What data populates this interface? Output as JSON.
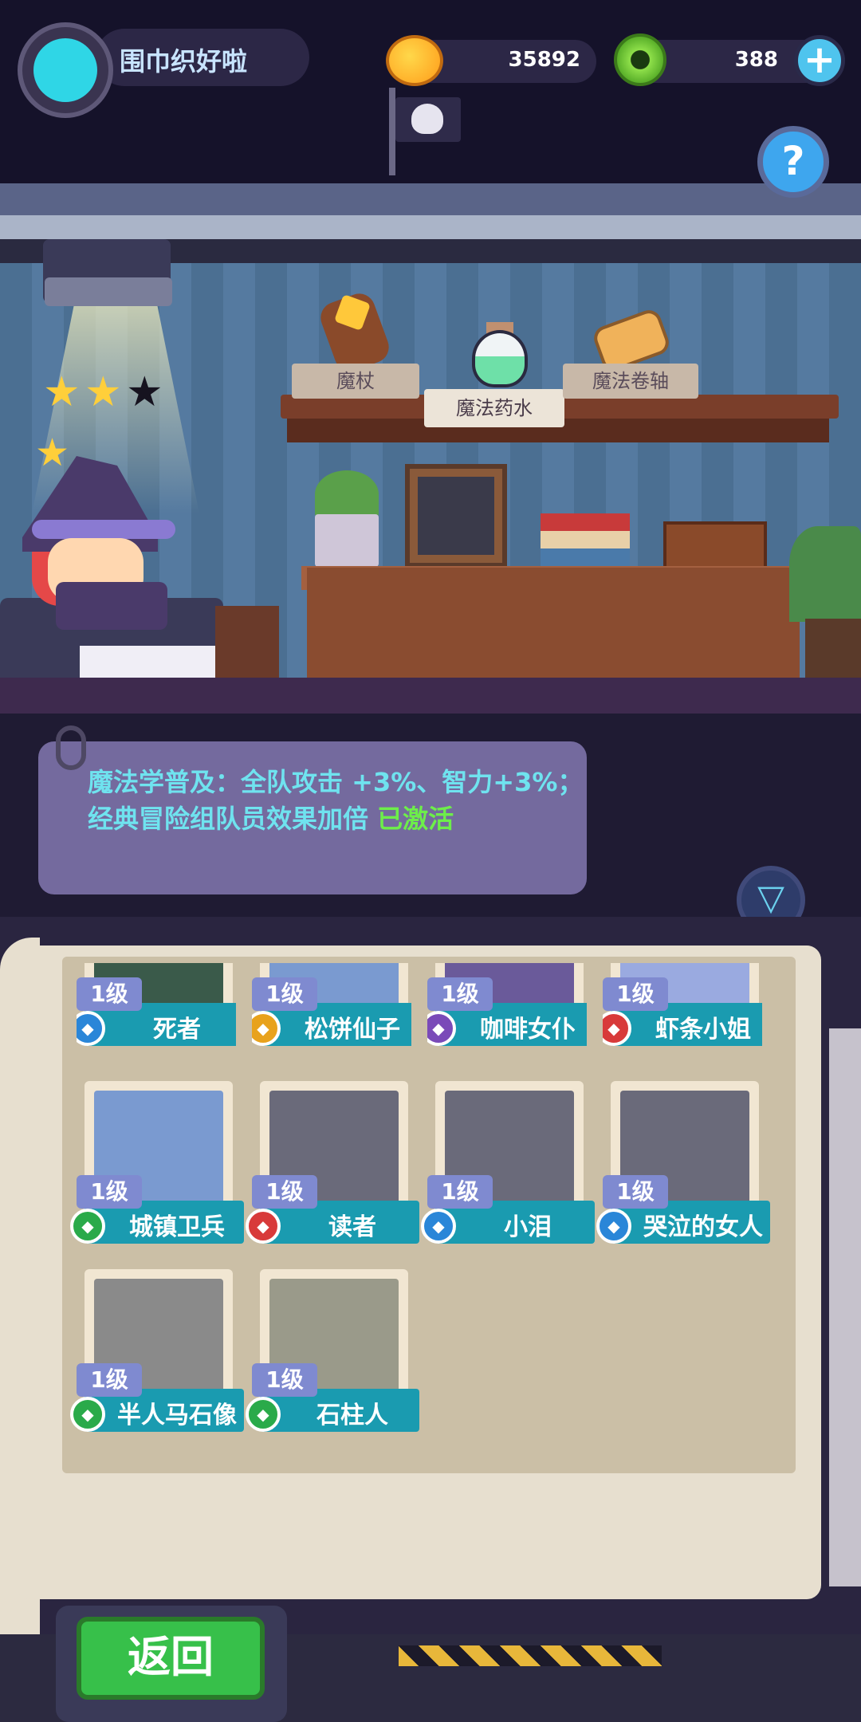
{
  "top_bar": {
    "player_name": "围巾织好啦",
    "coins": "35892",
    "gems": "388",
    "add_label": "+",
    "help_label": "?"
  },
  "room": {
    "stars_filled": 2,
    "stars_total": 3,
    "shelf_items": [
      {
        "label": "魔杖"
      },
      {
        "label": "魔法药水",
        "selected": true
      },
      {
        "label": "魔法卷轴"
      }
    ]
  },
  "info": {
    "line1": "魔法学普及：全队攻击 +3%、智力+3%；",
    "line2": "经典冒险组队员效果加倍",
    "status": "已激活"
  },
  "heroes": [
    {
      "level": "1级",
      "name": "死者",
      "badge_color": "#2a86d8",
      "portrait": "#3a5a4a"
    },
    {
      "level": "1级",
      "name": "松饼仙子",
      "badge_color": "#e8a21c",
      "portrait": "#7a9ad0"
    },
    {
      "level": "1级",
      "name": "咖啡女仆",
      "badge_color": "#7a4ab8",
      "portrait": "#6a5a9a"
    },
    {
      "level": "1级",
      "name": "虾条小姐",
      "badge_color": "#d83a3a",
      "portrait": "#9aaae0"
    },
    {
      "level": "1级",
      "name": "城镇卫兵",
      "badge_color": "#2aaa4a",
      "portrait": "#7a9ad0"
    },
    {
      "level": "1级",
      "name": "读者",
      "badge_color": "#d83a3a",
      "portrait": "#6a6a7a"
    },
    {
      "level": "1级",
      "name": "小泪",
      "badge_color": "#2a86d8",
      "portrait": "#6a6a7a"
    },
    {
      "level": "1级",
      "name": "哭泣的女人",
      "badge_color": "#2a86d8",
      "portrait": "#6a6a7a"
    },
    {
      "level": "1级",
      "name": "半人马石像",
      "badge_color": "#2aaa4a",
      "portrait": "#8a8a8a"
    },
    {
      "level": "1级",
      "name": "石柱人",
      "badge_color": "#2aaa4a",
      "portrait": "#9a9a8a"
    }
  ],
  "buttons": {
    "back": "返回",
    "filter_icon": "filter-icon"
  }
}
